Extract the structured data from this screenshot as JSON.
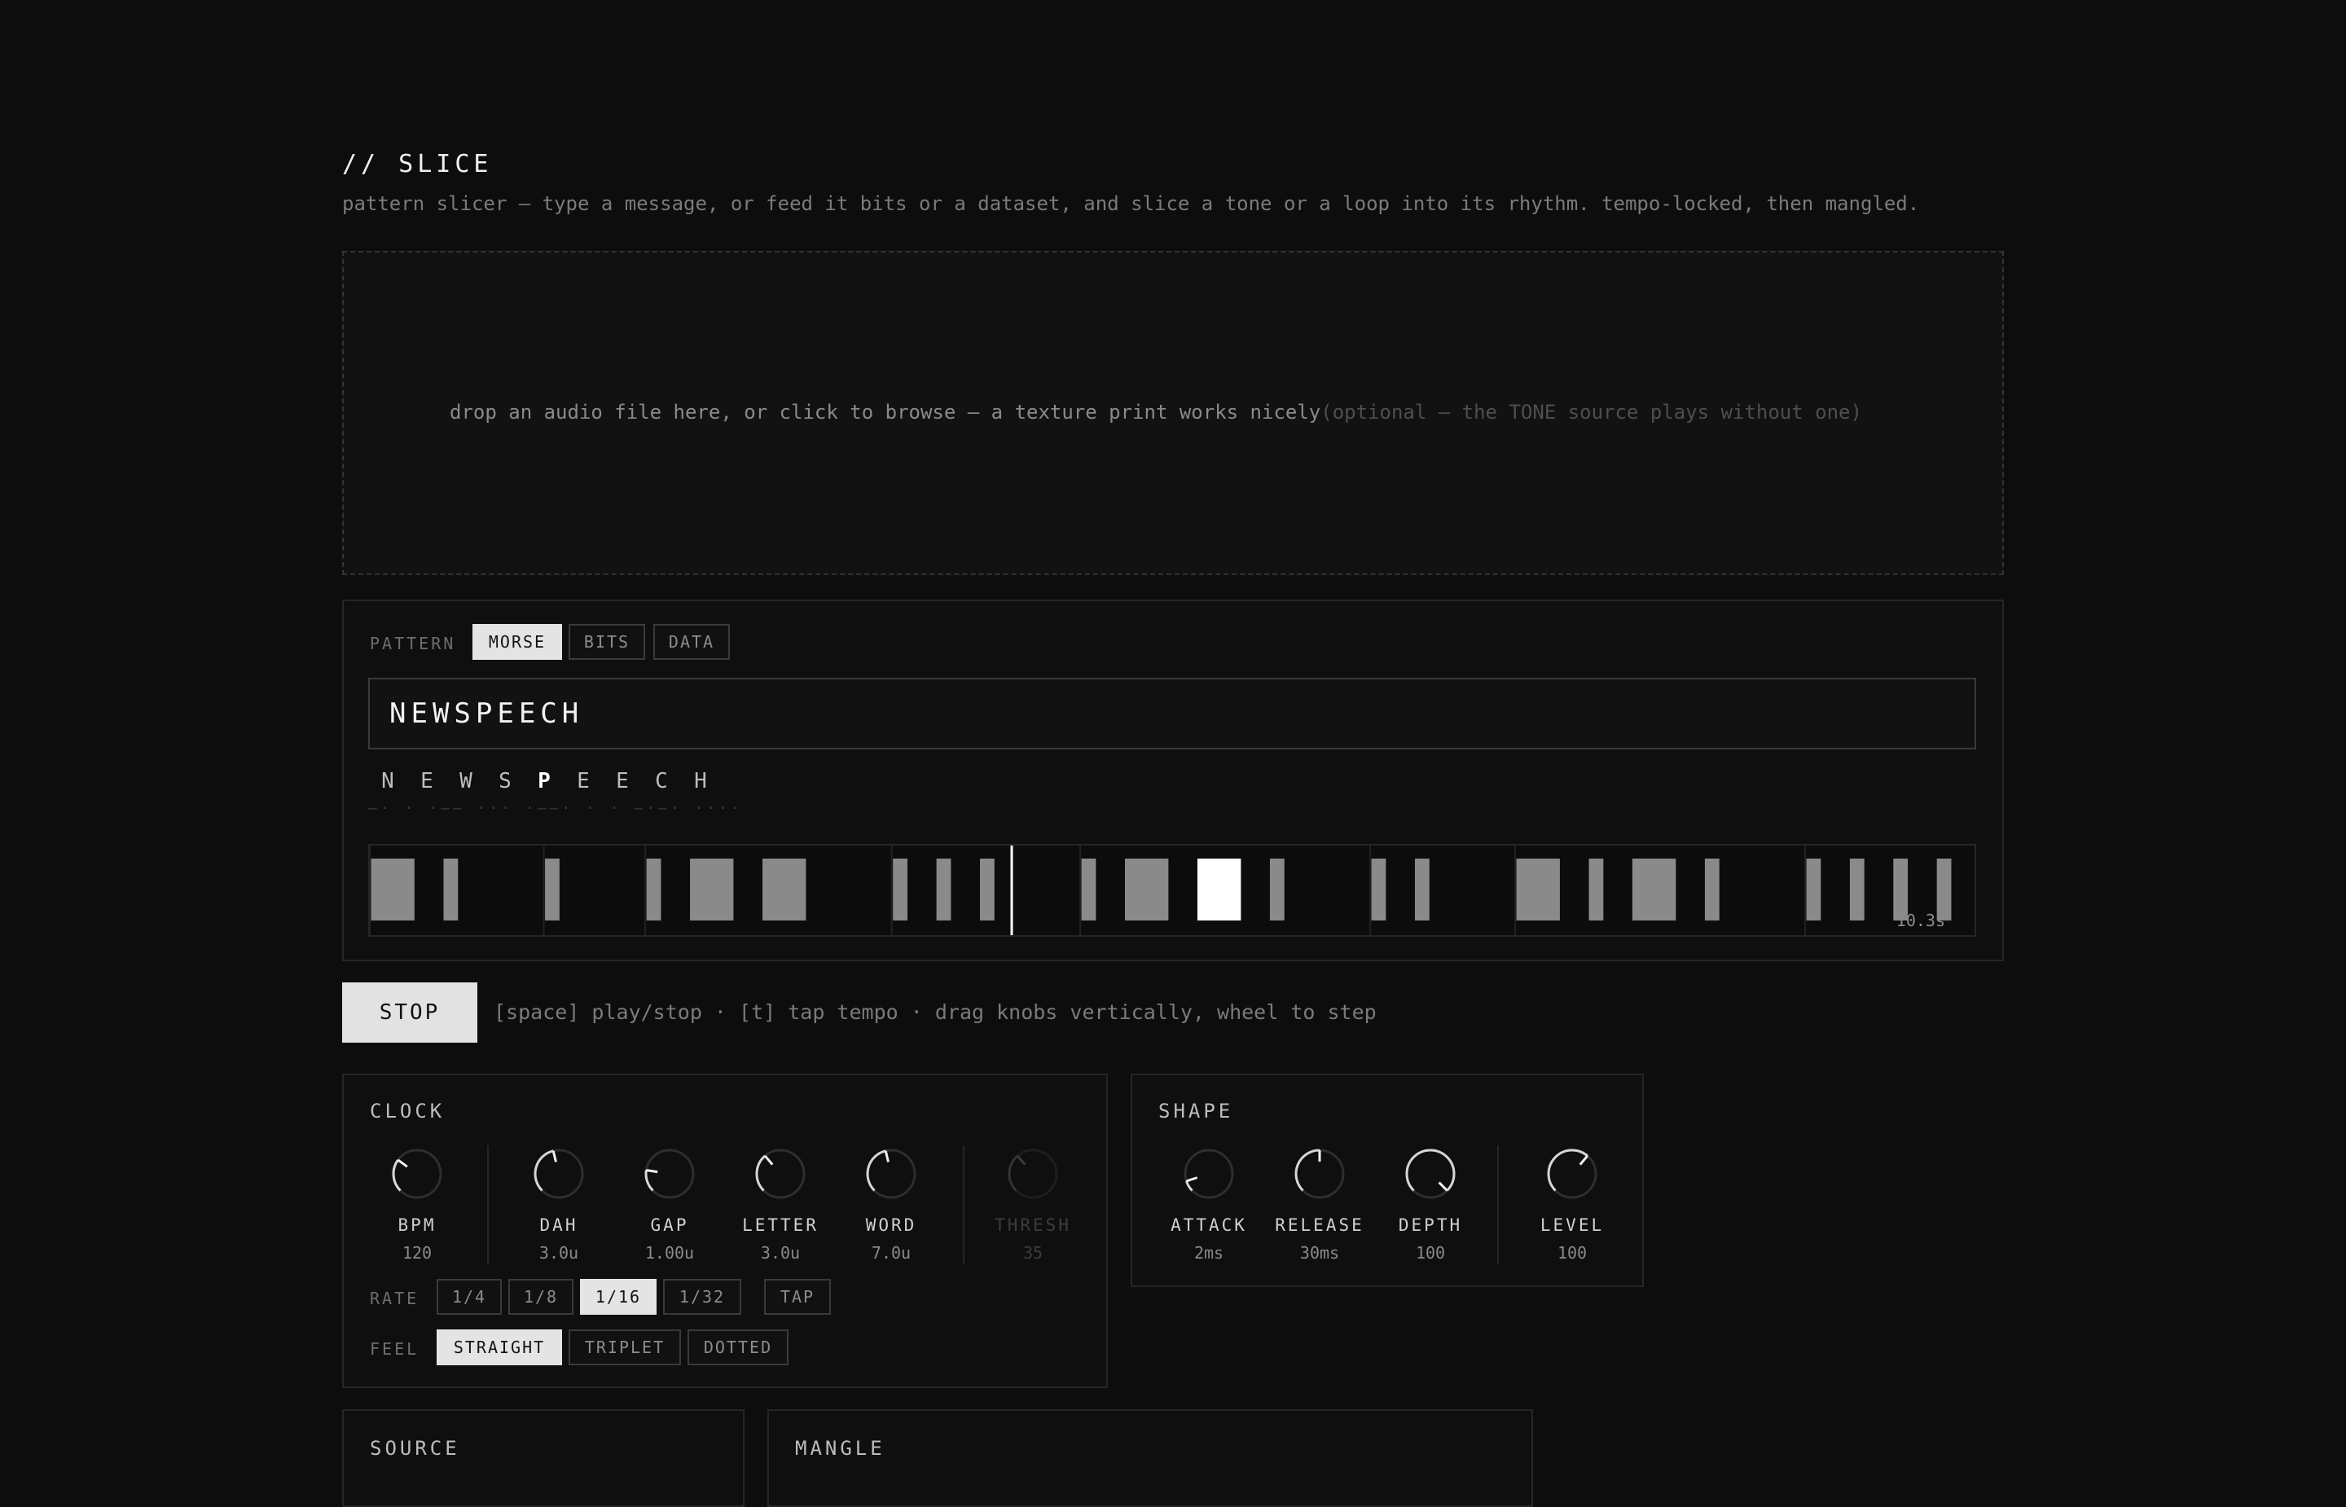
{
  "header": {
    "title": "// SLICE",
    "subtitle": "pattern slicer — type a message, or feed it bits or a dataset, and slice a tone or a loop into its rhythm. tempo-locked, then mangled."
  },
  "dropzone": {
    "text": "drop an audio file here, or click to browse — a texture print works nicely",
    "optional": "(optional — the TONE source plays without one)"
  },
  "pattern": {
    "label": "PATTERN",
    "modes": [
      "MORSE",
      "BITS",
      "DATA"
    ],
    "active_mode": "MORSE",
    "message": "NEWSPEECH",
    "letters": [
      "N",
      "E",
      "W",
      "S",
      "P",
      "E",
      "E",
      "C",
      "H"
    ],
    "current_letter_index": 4,
    "duration": "10.3s",
    "playhead_fraction": 0.4,
    "marks": [
      {
        "letter": "N",
        "dur": 3,
        "active": false
      },
      {
        "letter": "N",
        "dur": 1,
        "active": false
      },
      {
        "letter": "E",
        "dur": 1,
        "active": false
      },
      {
        "letter": "W",
        "dur": 1,
        "active": false
      },
      {
        "letter": "W",
        "dur": 3,
        "active": false
      },
      {
        "letter": "W",
        "dur": 3,
        "active": false
      },
      {
        "letter": "S",
        "dur": 1,
        "active": false
      },
      {
        "letter": "S",
        "dur": 1,
        "active": false
      },
      {
        "letter": "S",
        "dur": 1,
        "active": false
      },
      {
        "letter": "P",
        "dur": 1,
        "active": false
      },
      {
        "letter": "P",
        "dur": 3,
        "active": false
      },
      {
        "letter": "P",
        "dur": 3,
        "active": true
      },
      {
        "letter": "P",
        "dur": 1,
        "active": false
      },
      {
        "letter": "E",
        "dur": 1,
        "active": false
      },
      {
        "letter": "E",
        "dur": 1,
        "active": false
      },
      {
        "letter": "C",
        "dur": 3,
        "active": false
      },
      {
        "letter": "C",
        "dur": 1,
        "active": false
      },
      {
        "letter": "C",
        "dur": 3,
        "active": false
      },
      {
        "letter": "C",
        "dur": 1,
        "active": false
      },
      {
        "letter": "H",
        "dur": 1,
        "active": false
      },
      {
        "letter": "H",
        "dur": 1,
        "active": false
      },
      {
        "letter": "H",
        "dur": 1,
        "active": false
      },
      {
        "letter": "H",
        "dur": 1,
        "active": false
      }
    ]
  },
  "transport": {
    "stop_label": "STOP",
    "hint": "[space] play/stop  ·  [t] tap tempo  ·  drag knobs vertically, wheel to step"
  },
  "clock": {
    "title": "CLOCK",
    "knobs": [
      {
        "name": "BPM",
        "value": "120",
        "level": 0.3
      },
      {
        "name": "DAH",
        "value": "3.0u",
        "level": 0.45
      },
      {
        "name": "GAP",
        "value": "1.00u",
        "level": 0.2
      },
      {
        "name": "LETTER",
        "value": "3.0u",
        "level": 0.35
      },
      {
        "name": "WORD",
        "value": "7.0u",
        "level": 0.45
      },
      {
        "name": "THRESH",
        "value": "35",
        "level": 0.35,
        "disabled": true
      }
    ],
    "rate_label": "RATE",
    "rates": [
      "1/4",
      "1/8",
      "1/16",
      "1/32"
    ],
    "active_rate": "1/16",
    "tap_label": "TAP",
    "feel_label": "FEEL",
    "feels": [
      "STRAIGHT",
      "TRIPLET",
      "DOTTED"
    ],
    "active_feel": "STRAIGHT"
  },
  "shape": {
    "title": "SHAPE",
    "knobs": [
      {
        "name": "ATTACK",
        "value": "2ms",
        "level": 0.1
      },
      {
        "name": "RELEASE",
        "value": "30ms",
        "level": 0.5
      },
      {
        "name": "DEPTH",
        "value": "100",
        "level": 1.0
      },
      {
        "name": "LEVEL",
        "value": "100",
        "level": 0.65
      }
    ]
  },
  "source": {
    "title": "SOURCE"
  },
  "mangle": {
    "title": "MANGLE"
  },
  "colors": {
    "background": "#0d0d0d",
    "accent": "#e4e4e4",
    "mark": "#8a8a8a",
    "mark_active": "#ffffff"
  }
}
